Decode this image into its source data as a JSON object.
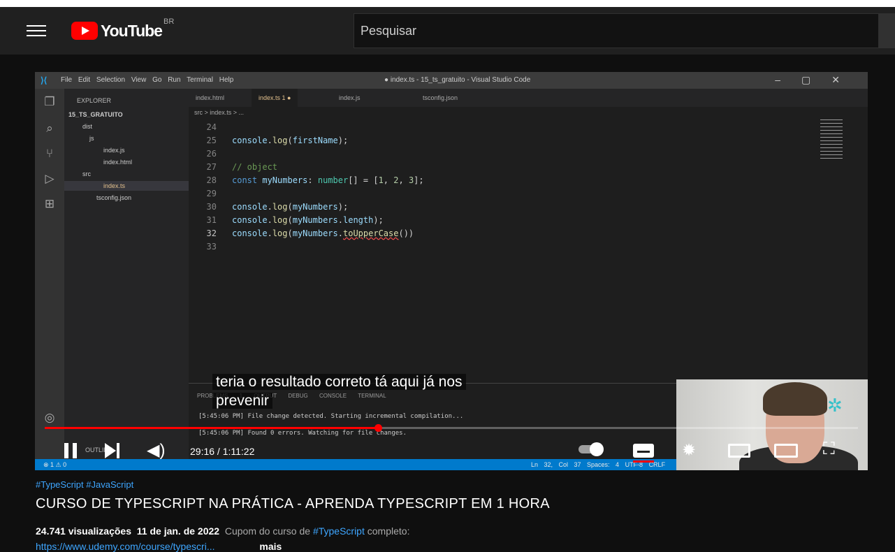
{
  "header": {
    "logo_text": "YouTube",
    "country_code": "BR",
    "search_placeholder": "Pesquisar"
  },
  "vscode": {
    "menu": "File Edit Selection View Go Run Terminal Help",
    "window_title": "● index.ts - 15_ts_gratuito - Visual Studio Code",
    "explorer_title": "EXPLORER",
    "tree": [
      {
        "label": "15_TS_GRATUITO"
      },
      {
        "label": "dist"
      },
      {
        "label": "js"
      },
      {
        "label": "index.js"
      },
      {
        "label": "index.html"
      },
      {
        "label": "src"
      },
      {
        "label": "index.ts"
      },
      {
        "label": "tsconfig.json"
      }
    ],
    "tabs": [
      "index.html",
      "index.ts 1 ●",
      "index.js",
      "tsconfig.json"
    ],
    "breadcrumb": "src > index.ts > ...",
    "line_numbers": [
      "24",
      "25",
      "26",
      "27",
      "28",
      "29",
      "30",
      "31",
      "32",
      "33"
    ],
    "panel_tabs": "PROBLEMS  1  OUTPUT  DEBUG CONSOLE  TERMINAL",
    "terminal_lines": [
      "[5:45:06 PM] File change detected. Starting incremental compilation...",
      "[5:45:06 PM] Found 0 errors. Watching for file changes."
    ],
    "status_left": "⊗ 1 ⚠ 0",
    "status_right": "Ln 32, Col 37  Spaces: 4  UTF-8  CRLF",
    "outline_label": "OUTLINE"
  },
  "player": {
    "caption_line1": "teria o resultado correto tá aqui já nos",
    "caption_line2": "prevenir",
    "time_display": "29:16 / 1:11:22",
    "progress_fraction": 0.41
  },
  "video": {
    "hashtags": "#TypeScript #JavaScript",
    "title": "CURSO DE TYPESCRIPT NA PRÁTICA - APRENDA TYPESCRIPT EM 1 HORA",
    "views": "24.741 visualizações",
    "date": "11 de jan. de 2022",
    "desc_prefix": "Cupom do curso de",
    "desc_hashtag": "#TypeScript",
    "desc_suffix": "completo:",
    "desc_link": "https://www.udemy.com/course/typescri...",
    "more_label": "mais"
  },
  "colors": {
    "brand_red": "#ff0000",
    "link_blue": "#3ea6ff",
    "vscode_blue": "#007acc"
  }
}
